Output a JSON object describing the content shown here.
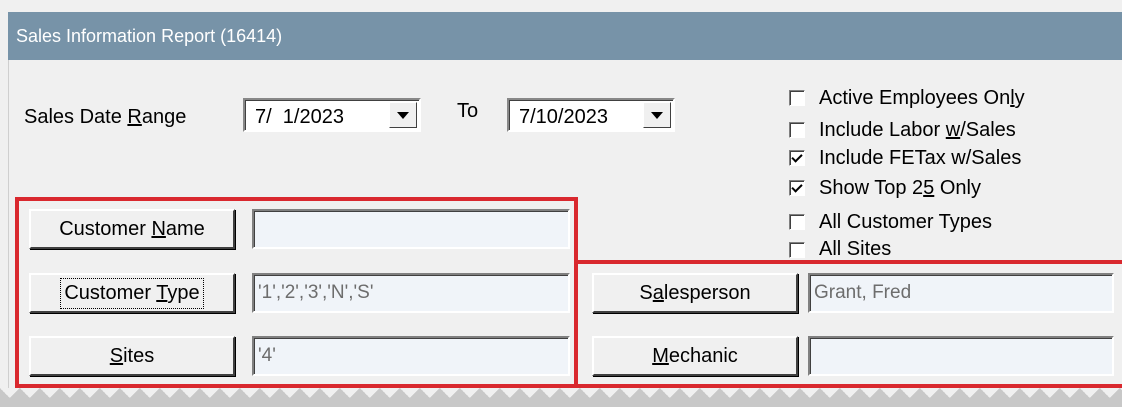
{
  "window": {
    "title": "Sales Information Report (16414)"
  },
  "date_range": {
    "label_pre": "Sales Date ",
    "label_ul": "R",
    "label_post": "ange",
    "from": "7/  1/2023",
    "to_label": "To",
    "to": "7/10/2023"
  },
  "checkboxes": [
    {
      "pre": "Active Employees On",
      "ul": "l",
      "post": "y",
      "checked": false
    },
    {
      "pre": "Include Labor ",
      "ul": "w",
      "post": "/Sales",
      "checked": false
    },
    {
      "pre": "Include FETax w/Sales",
      "ul": "",
      "post": "",
      "checked": true
    },
    {
      "pre": "Show Top 2",
      "ul": "5",
      "post": " Only",
      "checked": true
    },
    {
      "pre": "All Customer Types",
      "ul": "",
      "post": "",
      "checked": false
    },
    {
      "pre": "All Sites",
      "ul": "",
      "post": "",
      "checked": false
    }
  ],
  "buttons": {
    "customer_name": {
      "pre": "Customer ",
      "ul": "N",
      "post": "ame"
    },
    "customer_type": {
      "pre": "Customer ",
      "ul": "T",
      "post": "ype"
    },
    "sites": {
      "pre": "",
      "ul": "S",
      "post": "ites"
    },
    "salesperson": {
      "pre": "S",
      "ul": "a",
      "post": "lesperson"
    },
    "mechanic": {
      "pre": "",
      "ul": "M",
      "post": "echanic"
    }
  },
  "fields": {
    "customer_name": "",
    "customer_type": "'1','2','3','N','S'",
    "sites": "'4'",
    "salesperson": "Grant, Fred",
    "mechanic": ""
  },
  "colors": {
    "highlight": "#d9282e",
    "titlebar": "#7793a8"
  }
}
